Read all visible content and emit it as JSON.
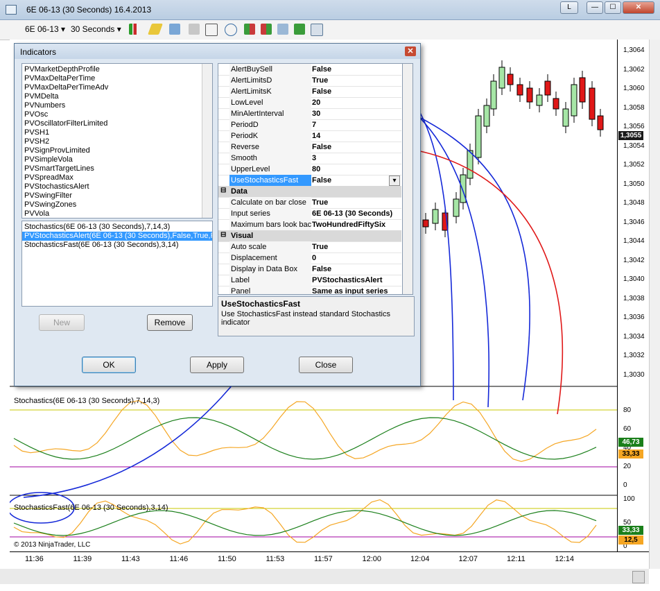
{
  "window": {
    "title": "6E 06-13 (30 Seconds)  16.4.2013",
    "buttons": {
      "extra": "L",
      "minimize": "—",
      "maximize": "☐",
      "close": "✕"
    }
  },
  "toolbar": {
    "instrument": "6E 06-13",
    "interval": "30 Seconds"
  },
  "price_axis": {
    "ticks": [
      "1,3064",
      "1,3062",
      "1,3060",
      "1,3058",
      "1,3056",
      "1,3054",
      "1,3052",
      "1,3050",
      "1,3048",
      "1,3046",
      "1,3044",
      "1,3042",
      "1,3040",
      "1,3038",
      "1,3036",
      "1,3034",
      "1,3032",
      "1,3030"
    ],
    "last_price": "1,3055",
    "last_price_color": "#1a1a1a"
  },
  "stoch_panel": {
    "label": "Stochastics(6E 06-13 (30 Seconds),7,14,3)",
    "ticks": [
      "80",
      "60",
      "40",
      "20",
      "0"
    ],
    "badges": [
      {
        "value": "46,73",
        "color": "#1a7f1a"
      },
      {
        "value": "33,33",
        "color": "#f5a623"
      }
    ]
  },
  "fast_panel": {
    "label": "StochasticsFast(6E 06-13 (30 Seconds),3,14)",
    "ticks": [
      "100",
      "50",
      "0"
    ],
    "badges": [
      {
        "value": "33,33",
        "color": "#1a7f1a"
      },
      {
        "value": "12,5",
        "color": "#f5a623"
      }
    ],
    "copyright": "© 2013 NinjaTrader, LLC"
  },
  "time_axis": {
    "ticks": [
      "11:36",
      "11:39",
      "11:43",
      "11:46",
      "11:50",
      "11:53",
      "11:57",
      "12:00",
      "12:04",
      "12:07",
      "12:11",
      "12:14"
    ]
  },
  "dialog": {
    "title": "Indicators",
    "close": "✕",
    "indicator_list": [
      "PVMarketDepthProfile",
      "PVMaxDeltaPerTime",
      "PVMaxDeltaPerTimeAdv",
      "PVMDelta",
      "PVNumbers",
      "PVOsc",
      "PVOscillatorFilterLimited",
      "PVSH1",
      "PVSH2",
      "PVSignProvLimited",
      "PVSimpleVola",
      "PVSmartTargetLines",
      "PVSpreadMax",
      "PVStochasticsAlert",
      "PVSwingFilter",
      "PVSwingZones",
      "PVVola"
    ],
    "applied_list": [
      {
        "label": "Stochastics(6E 06-13 (30 Seconds),7,14,3)",
        "selected": false
      },
      {
        "label": "PVStochasticsAlert(6E 06-13 (30 Seconds),False,True,Fa",
        "selected": true
      },
      {
        "label": "StochasticsFast(6E 06-13 (30 Seconds),3,14)",
        "selected": false
      }
    ],
    "properties": [
      {
        "name": "AlertBuySell",
        "value": "False"
      },
      {
        "name": "AlertLimitsD",
        "value": "True"
      },
      {
        "name": "AlertLimitsK",
        "value": "False"
      },
      {
        "name": "LowLevel",
        "value": "20"
      },
      {
        "name": "MinAlertInterval",
        "value": "30"
      },
      {
        "name": "PeriodD",
        "value": "7"
      },
      {
        "name": "PeriodK",
        "value": "14"
      },
      {
        "name": "Reverse",
        "value": "False"
      },
      {
        "name": "Smooth",
        "value": "3"
      },
      {
        "name": "UpperLevel",
        "value": "80"
      },
      {
        "name": "UseStochasticsFast",
        "value": "False",
        "selected": true
      },
      {
        "category": "Data"
      },
      {
        "name": "Calculate on bar close",
        "value": "True"
      },
      {
        "name": "Input series",
        "value": "6E 06-13 (30 Seconds)"
      },
      {
        "name": "Maximum bars look bac",
        "value": "TwoHundredFiftySix"
      },
      {
        "category": "Visual"
      },
      {
        "name": "Auto scale",
        "value": "True"
      },
      {
        "name": "Displacement",
        "value": "0"
      },
      {
        "name": "Display in Data Box",
        "value": "False"
      },
      {
        "name": "Label",
        "value": "PVStochasticsAlert"
      },
      {
        "name": "Panel",
        "value": "Same as input series"
      }
    ],
    "description_title": "UseStochasticsFast",
    "description_text": "Use StochasticsFast instead standard Stochastics indicator",
    "buttons": {
      "new": "New",
      "remove": "Remove",
      "ok": "OK",
      "apply": "Apply",
      "close": "Close"
    }
  }
}
